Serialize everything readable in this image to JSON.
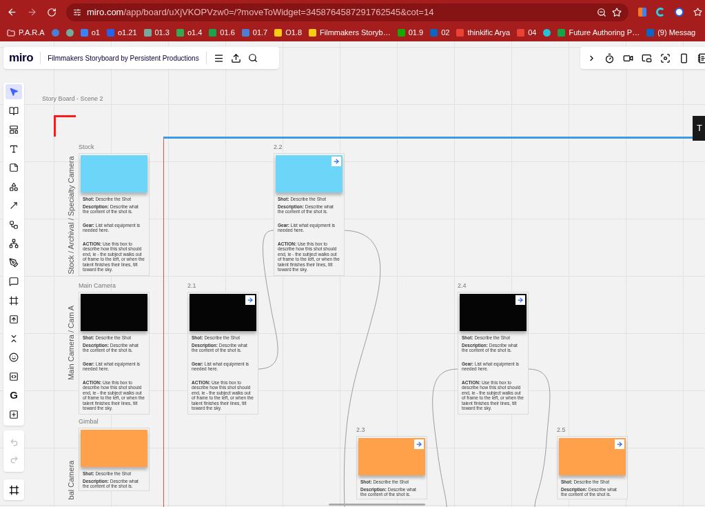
{
  "browser": {
    "url_host": "miro.com",
    "url_path": "/app/board/uXjVKOPVzw0=/?moveToWidget=3458764587291762545&cot=14",
    "bookmarks": [
      {
        "label": "P.A.R.A",
        "kind": "folder"
      },
      {
        "kind": "icon",
        "color": "#4a7fd6"
      },
      {
        "kind": "icon",
        "color": "#74aa9c"
      },
      {
        "label": "o1",
        "kind": "site",
        "color": "#3b82f6"
      },
      {
        "label": "o1.21",
        "kind": "site",
        "color": "#2563eb"
      },
      {
        "label": "01.3",
        "kind": "site",
        "color": "#74aa9c"
      },
      {
        "label": "o1.4",
        "kind": "site",
        "color": "#34a853"
      },
      {
        "label": "01.6",
        "kind": "site",
        "color": "#16a34a"
      },
      {
        "label": "01.7",
        "kind": "site",
        "color": "#4a7fd6"
      },
      {
        "label": "O1.8",
        "kind": "site",
        "color": "#facc15"
      },
      {
        "label": "Filmmakers Storyb…",
        "kind": "site",
        "color": "#facc15"
      },
      {
        "label": "01.9",
        "kind": "site",
        "color": "#14a800"
      },
      {
        "label": "02",
        "kind": "site",
        "color": "#0a66c2"
      },
      {
        "label": "thinkific Arya",
        "kind": "site",
        "color": "#ea4335"
      },
      {
        "label": "04",
        "kind": "site",
        "color": "#ea4335"
      },
      {
        "kind": "icon",
        "color": "#22c5d8"
      },
      {
        "label": "Future Authoring P…",
        "kind": "site",
        "color": "#16a34a"
      },
      {
        "label": "(9) Messag",
        "kind": "site",
        "color": "#0a66c2"
      }
    ]
  },
  "board": {
    "logo": "miro",
    "title": "Filmmakers Storyboard by Persistent Productions"
  },
  "toolbar": {
    "tools": [
      {
        "kind": "pointer",
        "selected": true
      },
      {
        "kind": "templates",
        "selected": false
      },
      {
        "kind": "layout",
        "selected": false
      },
      {
        "kind": "text",
        "selected": false
      },
      {
        "kind": "sticky",
        "selected": false
      },
      {
        "kind": "shapes",
        "selected": false
      },
      {
        "kind": "line",
        "selected": false
      },
      {
        "kind": "diagram",
        "selected": false
      },
      {
        "kind": "mindmap",
        "selected": false
      },
      {
        "kind": "pen",
        "selected": false
      },
      {
        "kind": "comment",
        "selected": false
      },
      {
        "kind": "frame",
        "selected": false
      },
      {
        "kind": "upload",
        "selected": false
      },
      {
        "kind": "collapse",
        "selected": false
      },
      {
        "kind": "sticker",
        "selected": false
      },
      {
        "kind": "embed",
        "selected": false
      },
      {
        "kind": "letter",
        "label": "G",
        "selected": false
      },
      {
        "kind": "more",
        "selected": false
      }
    ]
  },
  "frame": {
    "title": "Story Board - Scene 2",
    "overlay_label": "T"
  },
  "lanes": [
    "Stock / Archival / Specialty Camera",
    "Main Camera / Cam A",
    "bal Camera"
  ],
  "cards": [
    {
      "label": "Stock",
      "color": "#6dd5f8",
      "link": false,
      "fields": [
        "**Shot:** Describe the Shot",
        "**Description:** Describe what the content of the shot is.",
        "**Gear:** List what equipment is needed here.",
        "**ACTION:** Use this box to describe how this shot should end, ie - the subject walks out of frame to the left, or when the talent finishes their lines, tilt toward the sky."
      ]
    },
    {
      "label": "2.2",
      "color": "#6dd5f8",
      "link": true,
      "fields": [
        "**Shot:** Describe the Shot",
        "**Description:** Describe what the content of the shot is.",
        "**Gear:** List what equipment is needed here.",
        "**ACTION:** Use this box to describe how this shot should end, ie - the subject walks out of frame to the left, or when the talent finishes their lines, tilt toward the sky."
      ]
    },
    {
      "label": "Main Camera",
      "color": "#050505",
      "link": false,
      "fields": [
        "**Shot:** Describe the Shot",
        "**Description:** Describe what the content of the shot is.",
        "**Gear:** List what equipment is needed here.",
        "**ACTION:** Use this box to describe how this shot should end, ie - the subject walks out of frame to the left, or when the talent finishes their lines, tilt toward the sky."
      ]
    },
    {
      "label": "2.1",
      "color": "#050505",
      "link": true,
      "fields": [
        "**Shot:** Describe the Shot",
        "**Description:** Describe what the content of the shot is.",
        "**Gear:** List what equipment is needed here.",
        "**ACTION:** Use this box to describe how this shot should end, ie - the subject walks out of frame to the left, or when the talent finishes their lines, tilt toward the sky."
      ]
    },
    {
      "label": "2.4",
      "color": "#050505",
      "link": true,
      "fields": [
        "**Shot:** Describe the Shot",
        "**Description:** Describe what the content of the shot is.",
        "**Gear:** List what equipment is needed here.",
        "**ACTION:** Use this box to describe how this shot should end, ie - the subject walks out of frame to the left, or when the talent finishes their lines, tilt toward the sky."
      ]
    },
    {
      "label": "Gimbal",
      "color": "#ffa04a",
      "link": false,
      "fields": [
        "**Shot:** Describe the Shot",
        "**Description:** Describe what the content of the shot is."
      ]
    },
    {
      "label": "2.3",
      "color": "#ffa04a",
      "link": true,
      "fields": [
        "**Shot:** Describe the Shot",
        "**Description:** Describe what the content of the shot is."
      ]
    },
    {
      "label": "2.5",
      "color": "#ffa04a",
      "link": true,
      "fields": [
        "**Shot:** Describe the Shot",
        "**Description:** Describe what the content of the shot is."
      ]
    }
  ]
}
